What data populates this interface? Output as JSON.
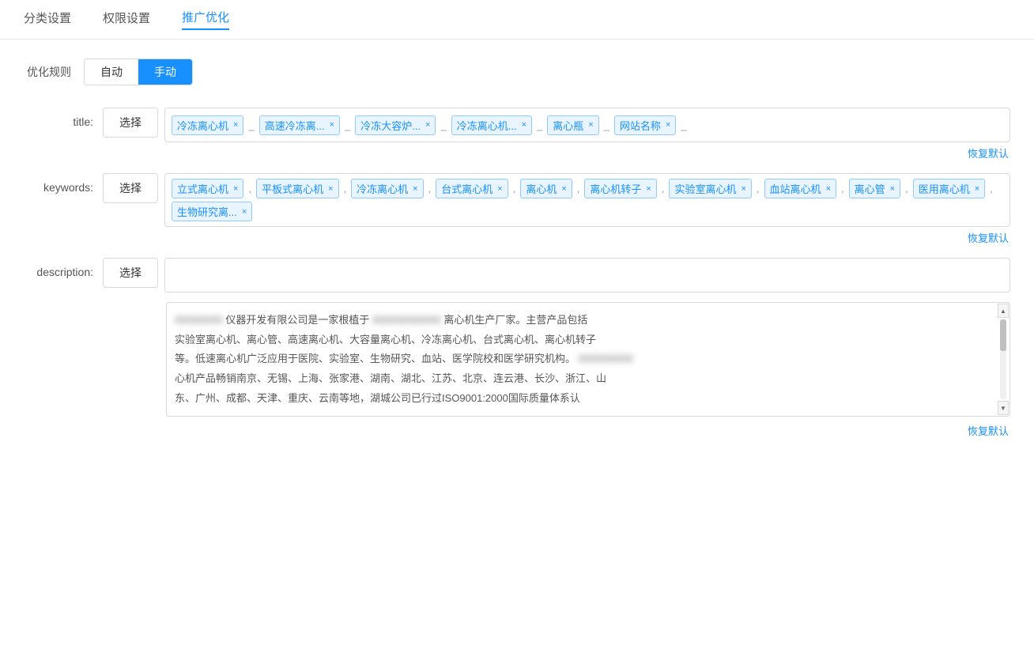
{
  "nav": {
    "items": [
      {
        "id": "classify",
        "label": "分类设置",
        "active": false
      },
      {
        "id": "permission",
        "label": "权限设置",
        "active": false
      },
      {
        "id": "promotion",
        "label": "推广优化",
        "active": true
      }
    ]
  },
  "optimization_rule": {
    "label": "优化规则",
    "options": [
      {
        "id": "auto",
        "label": "自动",
        "active": false
      },
      {
        "id": "manual",
        "label": "手动",
        "active": true
      }
    ]
  },
  "title_field": {
    "label": "title:",
    "select_btn": "选择",
    "tags": [
      {
        "text": "冷冻离心机",
        "sep": "_"
      },
      {
        "text": "高速冷冻离...",
        "sep": "_"
      },
      {
        "text": "冷冻大容炉...",
        "sep": "_"
      },
      {
        "text": "冷冻离心机...",
        "sep": "_"
      },
      {
        "text": "离心瓶",
        "sep": "_"
      },
      {
        "text": "网站名称",
        "sep": ""
      }
    ],
    "restore_label": "恢复默认"
  },
  "keywords_field": {
    "label": "keywords:",
    "select_btn": "选择",
    "tags": [
      {
        "text": "立式离心机",
        "sep": ","
      },
      {
        "text": "平板式离心机",
        "sep": ","
      },
      {
        "text": "冷冻离心机",
        "sep": ","
      },
      {
        "text": "台式离心机",
        "sep": ","
      },
      {
        "text": "离心机",
        "sep": ","
      },
      {
        "text": "离心机转子",
        "sep": ","
      },
      {
        "text": "实验室离心机",
        "sep": ","
      },
      {
        "text": "血站离心机",
        "sep": ","
      },
      {
        "text": "离心管",
        "sep": ","
      },
      {
        "text": "医用离心机",
        "sep": ","
      },
      {
        "text": "生物研究离...",
        "sep": ""
      }
    ],
    "restore_label": "恢复默认"
  },
  "description_field": {
    "label": "description:",
    "select_btn": "选择",
    "restore_label": "恢复默认",
    "text_line1": "仪器开发有限公司是一家根植于",
    "text_blur1": "XXXXXXXX",
    "text_line1_end": "离心机生产厂家。主营产品包括",
    "text_line2": "实验室离心机、离心管、高速离心机、大容量离心机、冷冻离心机、台式离心机、离心机转子",
    "text_line3": "等。低速离心机广泛应用于医院、实验室、生物研究、血站、医学院校和医学研究机构。离",
    "text_blur2": "XXXXXXXX",
    "text_line3_end": "",
    "text_line4": "心机产品畅销南京、无锡、上海、张家港、湖南、湖北、江苏、北京、连云港、长沙、浙江、山",
    "text_line5": "东、广州、成都、天津、重庆、云南等地，湖城公司已行过ISO9001:2000国际质量体系认",
    "scrollbar": {
      "up_label": "▲",
      "down_label": "▼"
    }
  }
}
